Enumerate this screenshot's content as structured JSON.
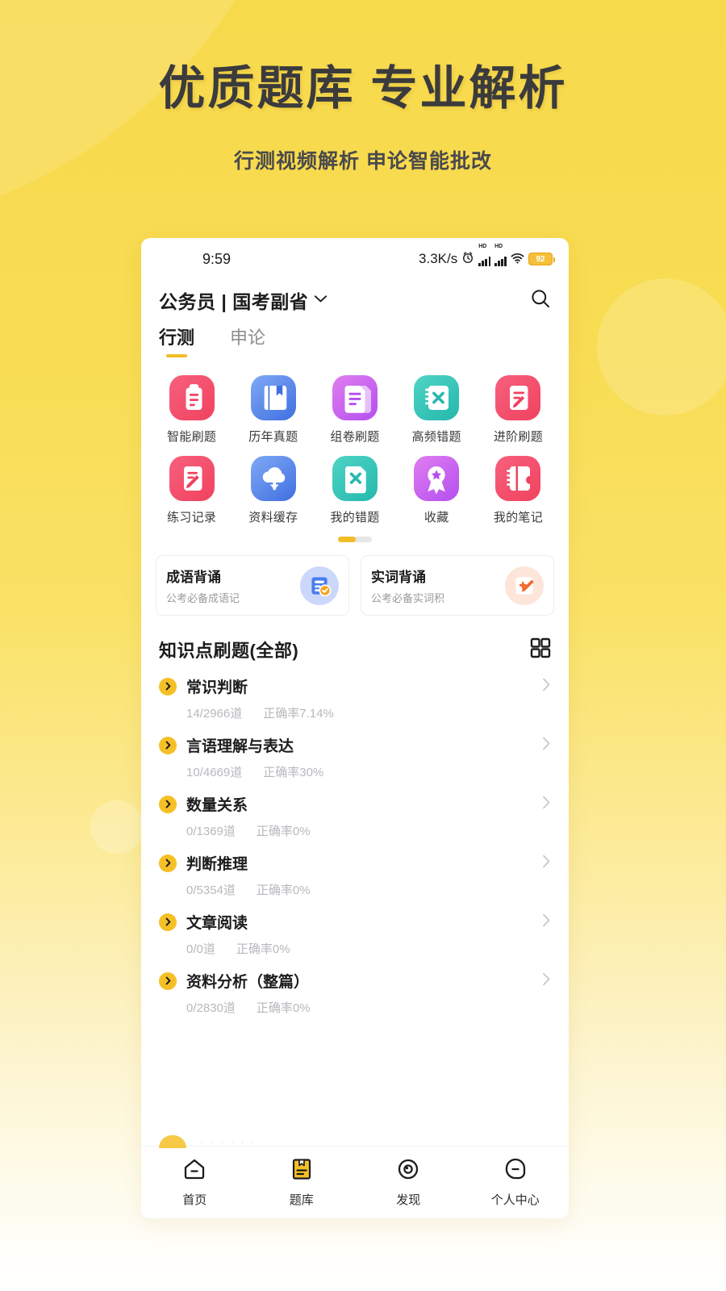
{
  "hero": {
    "title": "优质题库 专业解析",
    "subtitle": "行测视频解析 申论智能批改"
  },
  "colors": {
    "page_background": "#f7d94c",
    "accent_yellow": "#f5c026",
    "tab_underline": "#f2bd26",
    "battery_fill": "#f5bf3a"
  },
  "statusbar": {
    "time": "9:59",
    "network_speed": "3.3K/s",
    "alarm_icon": "alarm-clock-icon",
    "signal_1_label": "HD",
    "signal_2_label": "HD",
    "wifi_icon": "wifi-icon",
    "battery_level": "92"
  },
  "header": {
    "title": "公务员 | 国考副省",
    "dropdown_icon": "chevron-down-icon",
    "search_icon": "search-icon"
  },
  "tabs": [
    {
      "label": "行测",
      "active": true
    },
    {
      "label": "申论",
      "active": false
    }
  ],
  "icon_grid": {
    "rows": [
      [
        {
          "label": "智能刷题",
          "icon": "document-lines-icon",
          "c1": "#f7607d",
          "c2": "#f0425f"
        },
        {
          "label": "历年真题",
          "icon": "bookmark-book-icon",
          "c1": "#7fa9f5",
          "c2": "#3f6fe0"
        },
        {
          "label": "组卷刷题",
          "icon": "paper-stack-icon",
          "c1": "#e07ef0",
          "c2": "#b44ef0"
        },
        {
          "label": "高频错题",
          "icon": "notebook-x-icon",
          "c1": "#4ed4c4",
          "c2": "#26b8ad"
        },
        {
          "label": "进阶刷题",
          "icon": "document-pen-icon",
          "c1": "#f7607d",
          "c2": "#f0425f"
        }
      ],
      [
        {
          "label": "练习记录",
          "icon": "note-pencil-icon",
          "c1": "#f7607d",
          "c2": "#f0425f"
        },
        {
          "label": "资料缓存",
          "icon": "cloud-download-icon",
          "c1": "#7fa9f5",
          "c2": "#3f6fe0"
        },
        {
          "label": "我的错题",
          "icon": "page-x-icon",
          "c1": "#4ed4c4",
          "c2": "#26b8ad"
        },
        {
          "label": "收藏",
          "icon": "medal-star-icon",
          "c1": "#e07ef0",
          "c2": "#b44ef0"
        },
        {
          "label": "我的笔记",
          "icon": "notebook-icon",
          "c1": "#f7607d",
          "c2": "#f0425f"
        }
      ]
    ],
    "pager": {
      "pages": 2,
      "current": 1
    }
  },
  "promos": [
    {
      "title": "成语背诵",
      "subtitle": "公考必备成语记",
      "icon": "document-check-icon",
      "badge_color": "#ccd8fb"
    },
    {
      "title": "实词背诵",
      "subtitle": "公考必备实词积",
      "icon": "pencil-plus-icon",
      "badge_color": "#fde5da"
    }
  ],
  "section": {
    "title": "知识点刷题(全部)",
    "grid_view_icon": "grid-view-icon"
  },
  "knowledge_points": [
    {
      "name": "常识判断",
      "progress": "14/2966道",
      "accuracy": "正确率7.14%"
    },
    {
      "name": "言语理解与表达",
      "progress": "10/4669道",
      "accuracy": "正确率30%"
    },
    {
      "name": "数量关系",
      "progress": "0/1369道",
      "accuracy": "正确率0%"
    },
    {
      "name": "判断推理",
      "progress": "0/5354道",
      "accuracy": "正确率0%"
    },
    {
      "name": "文章阅读",
      "progress": "0/0道",
      "accuracy": "正确率0%"
    },
    {
      "name": "资料分析（整篇）",
      "progress": "0/2830道",
      "accuracy": "正确率0%"
    }
  ],
  "bottom_nav": [
    {
      "label": "首页",
      "icon": "home-icon",
      "active": false
    },
    {
      "label": "题库",
      "icon": "book-icon",
      "active": true
    },
    {
      "label": "发现",
      "icon": "compass-icon",
      "active": false
    },
    {
      "label": "个人中心",
      "icon": "profile-icon",
      "active": false
    }
  ]
}
